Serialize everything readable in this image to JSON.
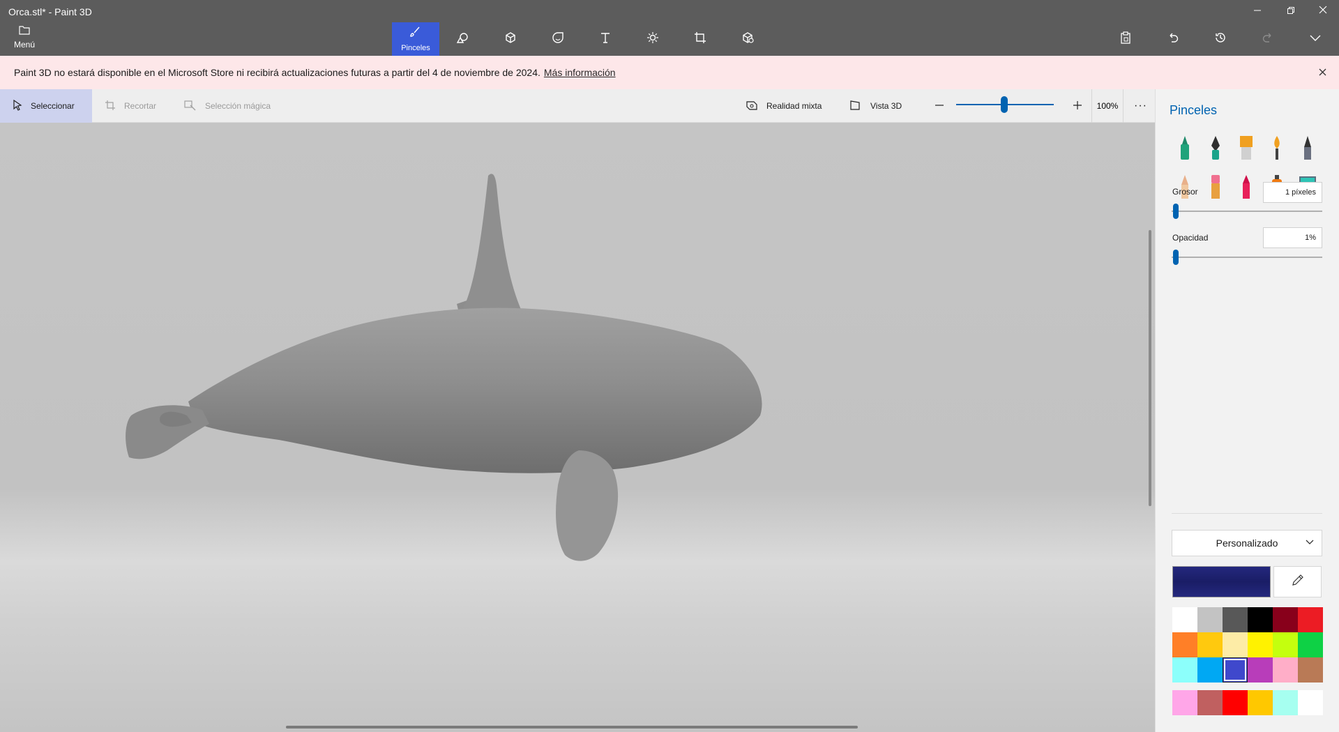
{
  "app": {
    "title": "Orca.stl* - Paint 3D"
  },
  "menu": {
    "label": "Menú"
  },
  "window_controls": [
    {
      "name": "minimize-icon"
    },
    {
      "name": "restore-icon"
    },
    {
      "name": "close-icon"
    }
  ],
  "tool_tabs": [
    {
      "name": "brushes",
      "label": "Pinceles",
      "icon": "brush-icon",
      "active": true
    },
    {
      "name": "2d-shapes",
      "label": "",
      "icon": "shapes-2d-icon"
    },
    {
      "name": "3d-shapes",
      "label": "",
      "icon": "cube-icon"
    },
    {
      "name": "stickers",
      "label": "",
      "icon": "sticker-icon"
    },
    {
      "name": "text",
      "label": "",
      "icon": "text-icon"
    },
    {
      "name": "effects",
      "label": "",
      "icon": "effects-icon"
    },
    {
      "name": "canvas",
      "label": "",
      "icon": "canvas-icon"
    },
    {
      "name": "3d-library",
      "label": "",
      "icon": "library-3d-icon"
    }
  ],
  "right_actions": [
    {
      "name": "paste-icon"
    },
    {
      "name": "undo-icon"
    },
    {
      "name": "history-icon"
    },
    {
      "name": "redo-icon",
      "disabled": true
    },
    {
      "name": "expand-icon"
    }
  ],
  "notice": {
    "text": "Paint 3D no estará disponible en el Microsoft Store ni recibirá actualizaciones futuras a partir del 4 de noviembre de 2024.",
    "link": "Más información"
  },
  "toolbar": {
    "select": "Seleccionar",
    "crop": "Recortar",
    "magic_select": "Selección mágica",
    "mixed_reality": "Realidad mixta",
    "view3d": "Vista 3D",
    "zoom": "100%",
    "more": "···"
  },
  "panel": {
    "title": "Pinceles",
    "brushes": [
      "marker-icon",
      "calligraphy-pen-icon",
      "oil-brush-icon",
      "watercolor-icon",
      "pixel-pen-icon",
      "pencil-icon",
      "eraser-icon",
      "crayon-icon",
      "spray-can-icon",
      "fill-bucket-icon"
    ],
    "thickness_label": "Grosor",
    "thickness_value": "1 píxeles",
    "thickness_level": 0.01,
    "opacity_label": "Opacidad",
    "opacity_value": "1%",
    "opacity_level": 0.01,
    "finish": "Personalizado",
    "current_color": "#24287d",
    "palette": [
      "#ffffff",
      "#c3c3c3",
      "#585858",
      "#000000",
      "#88001b",
      "#ec1c24",
      "#ff7f27",
      "#ffc90e",
      "#fdeca6",
      "#fff200",
      "#c4ff0e",
      "#0ed145",
      "#8cfffb",
      "#00a8f3",
      "#3f48cc",
      "#b83dba",
      "#ffaec8",
      "#b97a56"
    ],
    "selected_swatch": 14,
    "custom_colors": [
      "#ffa6e8",
      "#c06060",
      "#ff0000",
      "#ffc800",
      "#a6fff0",
      "#ffffff"
    ]
  }
}
